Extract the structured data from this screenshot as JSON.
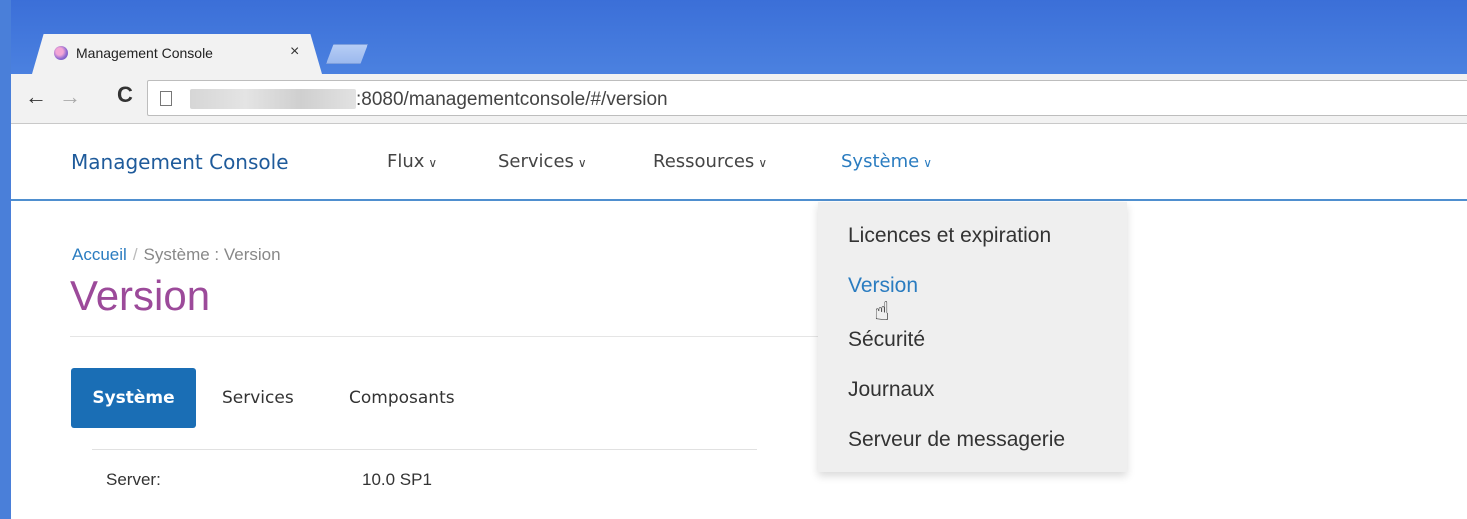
{
  "browser": {
    "tab_title": "Management Console",
    "close_glyph": "×",
    "url_visible": ":8080/managementconsole/#/version",
    "back_glyph": "←",
    "forward_glyph": "→",
    "reload_glyph": "C"
  },
  "navbar": {
    "brand": "Management Console",
    "menus": [
      {
        "label": "Flux"
      },
      {
        "label": "Services"
      },
      {
        "label": "Ressources"
      },
      {
        "label": "Système"
      }
    ],
    "chevron_glyph": "∨"
  },
  "dropdown": {
    "items": [
      {
        "label": "Licences et expiration"
      },
      {
        "label": "Version"
      },
      {
        "label": "Sécurité"
      },
      {
        "label": "Journaux"
      },
      {
        "label": "Serveur de messagerie"
      }
    ],
    "hovered_item": "Version"
  },
  "breadcrumb": {
    "home": "Accueil",
    "separator": "/",
    "current": "Système : Version"
  },
  "page": {
    "title": "Version"
  },
  "tabs": [
    {
      "label": "Système",
      "active": true
    },
    {
      "label": "Services",
      "active": false
    },
    {
      "label": "Composants",
      "active": false
    }
  ],
  "table": {
    "rows": [
      {
        "label": "Server:",
        "value": "10.0 SP1"
      }
    ]
  },
  "colors": {
    "brand": "#1f5b9b",
    "link": "#2a7cc0",
    "title": "#9c4a9a",
    "active_tab": "#1a6eb5"
  },
  "icons": {
    "cursor": "hand-pointer-icon",
    "favicon": "app-favicon-icon",
    "page": "page-icon"
  }
}
